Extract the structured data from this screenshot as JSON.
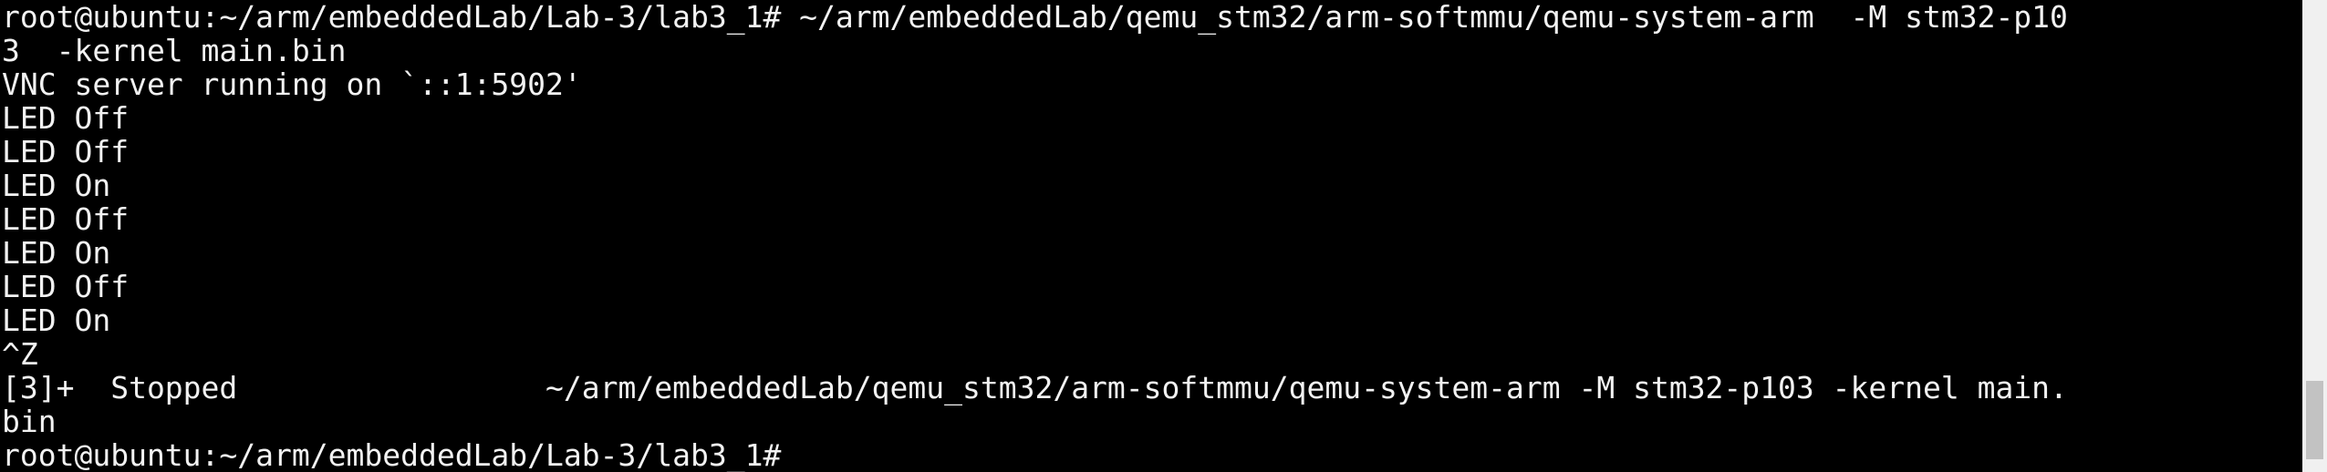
{
  "terminal": {
    "lines": [
      "root@ubuntu:~/arm/embeddedLab/Lab-3/lab3_1# ~/arm/embeddedLab/qemu_stm32/arm-softmmu/qemu-system-arm  -M stm32-p10",
      "3  -kernel main.bin",
      "VNC server running on `::1:5902'",
      "LED Off",
      "LED Off",
      "LED On",
      "LED Off",
      "LED On",
      "LED Off",
      "LED On",
      "^Z",
      "[3]+  Stopped                 ~/arm/embeddedLab/qemu_stm32/arm-softmmu/qemu-system-arm -M stm32-p103 -kernel main.",
      "bin",
      "root@ubuntu:~/arm/embeddedLab/Lab-3/lab3_1# "
    ]
  },
  "colors": {
    "background": "#000000",
    "foreground": "#f2f2f2",
    "scrollbar_track": "#f0f0f0",
    "scrollbar_thumb": "#c2c2c2"
  }
}
